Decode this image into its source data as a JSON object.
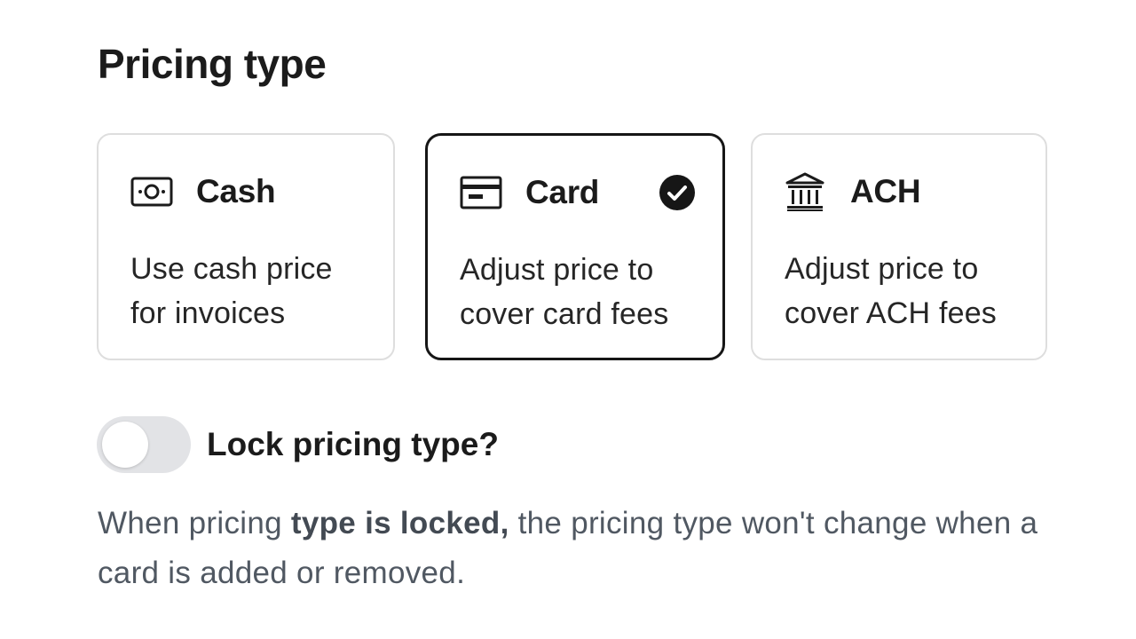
{
  "section_title": "Pricing type",
  "options": [
    {
      "id": "cash",
      "title": "Cash",
      "icon": "cash-bill-icon",
      "description": "Use cash price for invoices",
      "selected": false
    },
    {
      "id": "card",
      "title": "Card",
      "icon": "credit-card-icon",
      "description": "Adjust price to cover card fees",
      "selected": true,
      "selected_icon": "check-circle-icon"
    },
    {
      "id": "ach",
      "title": "ACH",
      "icon": "bank-icon",
      "description": "Adjust price to cover ACH fees",
      "selected": false
    }
  ],
  "lock_toggle": {
    "label": "Lock pricing type?",
    "checked": false
  },
  "help": {
    "prefix": "When pricing ",
    "emphasis": "type is locked,",
    "suffix": " the pricing type won't change when a card is added or removed."
  },
  "colors": {
    "selected_border": "#161616",
    "unselected_border": "#dedede",
    "toggle_off_track": "#e2e3e6",
    "help_text": "#505862"
  }
}
